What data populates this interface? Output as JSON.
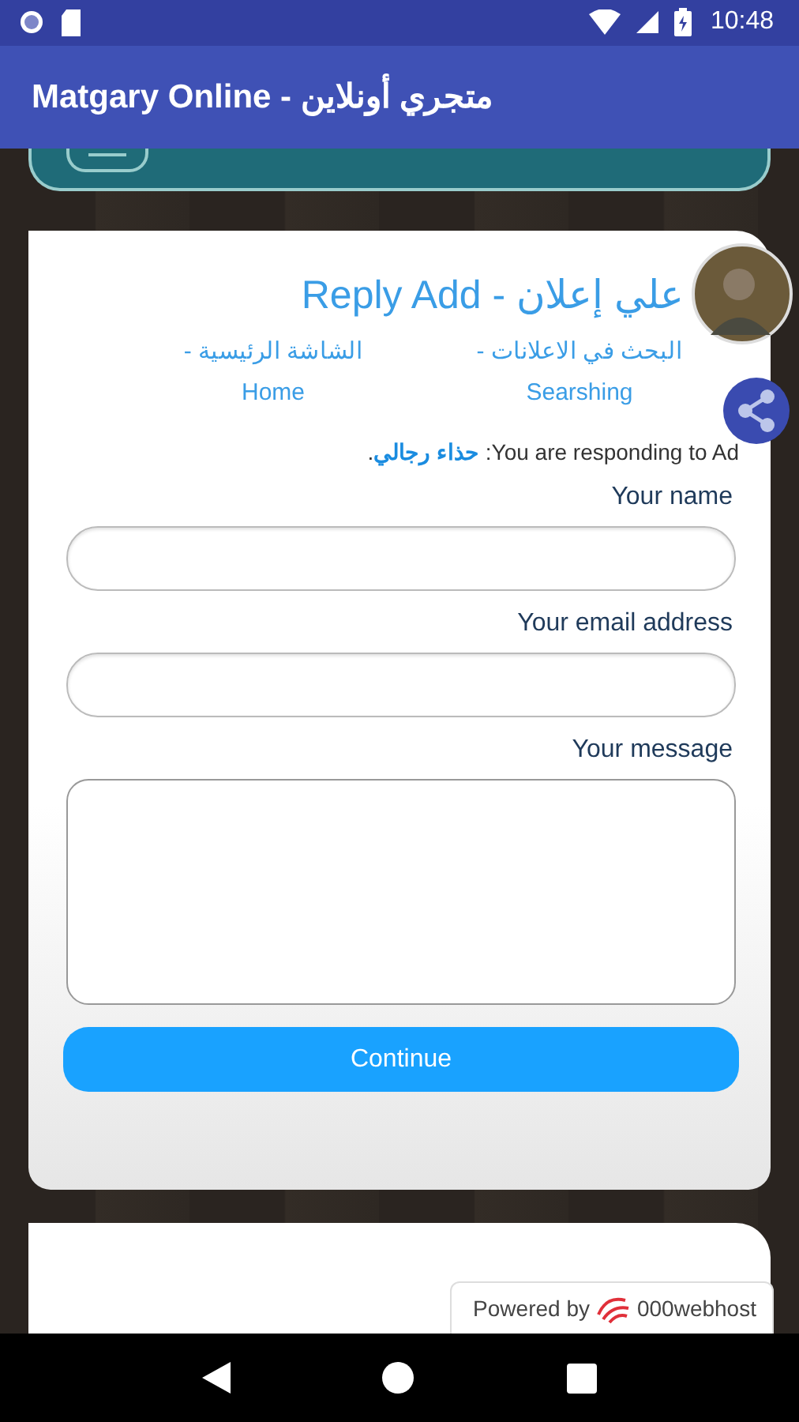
{
  "status_bar": {
    "time": "10:48"
  },
  "app_bar": {
    "title": "Matgary Online - متجري أونلاين"
  },
  "card": {
    "title": "علي إعلان - Reply Add",
    "breadcrumbs": [
      "البحث في الاعلانات - Searshing",
      "الشاشة الرئيسية - Home"
    ],
    "notice": "You are responding to Ad: **حذاء رجالي**.",
    "fields": [
      {
        "label": "Your name",
        "kind": "input"
      },
      {
        "label": "Your email address",
        "kind": "input"
      },
      {
        "label": "Your message",
        "kind": "textarea"
      }
    ],
    "submit": "Continue"
  },
  "badge": {
    "prefix": "Powered by",
    "brand": "000webhost"
  }
}
